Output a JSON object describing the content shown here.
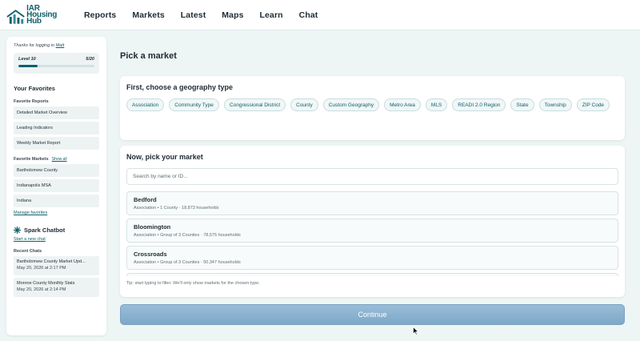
{
  "brand": {
    "line1": "IAR",
    "line2": "Housing Hub"
  },
  "nav": [
    "Reports",
    "Markets",
    "Latest",
    "Maps",
    "Learn",
    "Chat"
  ],
  "sidebar": {
    "welcome_prefix": "Thanks for logging in ",
    "user": "Matt",
    "level_label": "Level 10",
    "level_progress": "5/20",
    "level_fraction": 0.25,
    "favorites_title": "Your Favorites",
    "favorite_reports_title": "Favorite Reports",
    "favorite_reports": [
      "Detailed Market Overview",
      "Leading Indicators",
      "Weekly Market Report"
    ],
    "favorite_markets_title": "Favorite Markets",
    "show_all": "Show all",
    "favorite_markets": [
      "Bartholomew County",
      "Indianapolis MSA",
      "Indiana"
    ],
    "manage_favorites": "Manage favorites",
    "spark_title": "Spark Chatbot",
    "new_chat": "Start a new chat",
    "recent_chats_title": "Recent Chats",
    "recent_chats": [
      {
        "title": "Bartholomew County Market Upd...",
        "date": "May 20, 2026 at 2:17 PM"
      },
      {
        "title": "Monroe County Monthly Stats",
        "date": "May 20, 2026 at 2:14 PM"
      }
    ]
  },
  "main": {
    "title": "Pick a market",
    "geo_title": "First, choose a geography type",
    "geo_types": [
      "Association",
      "Community Type",
      "Congressional District",
      "County",
      "Custom Geography",
      "Metro Area",
      "MLS",
      "READI 2.0 Region",
      "State",
      "Township",
      "ZIP Code"
    ],
    "market_title": "Now, pick your market",
    "search_placeholder": "Search by name or ID...",
    "markets": [
      {
        "name": "Bedford",
        "sub": "Association • 1 County · 18,873 households"
      },
      {
        "name": "Bloomington",
        "sub": "Association • Group of 3 Counties · 78,575 households"
      },
      {
        "name": "Crossroads",
        "sub": "Association • Group of 3 Counties · 50,347 households"
      },
      {
        "name": "",
        "sub": ""
      }
    ],
    "tip": "Tip: start typing to filter. We'll only show markets for the chosen type.",
    "continue_label": "Continue"
  },
  "colors": {
    "accent": "#0f5f6b",
    "continue": "#8db3d1",
    "background": "#eef5f5"
  }
}
